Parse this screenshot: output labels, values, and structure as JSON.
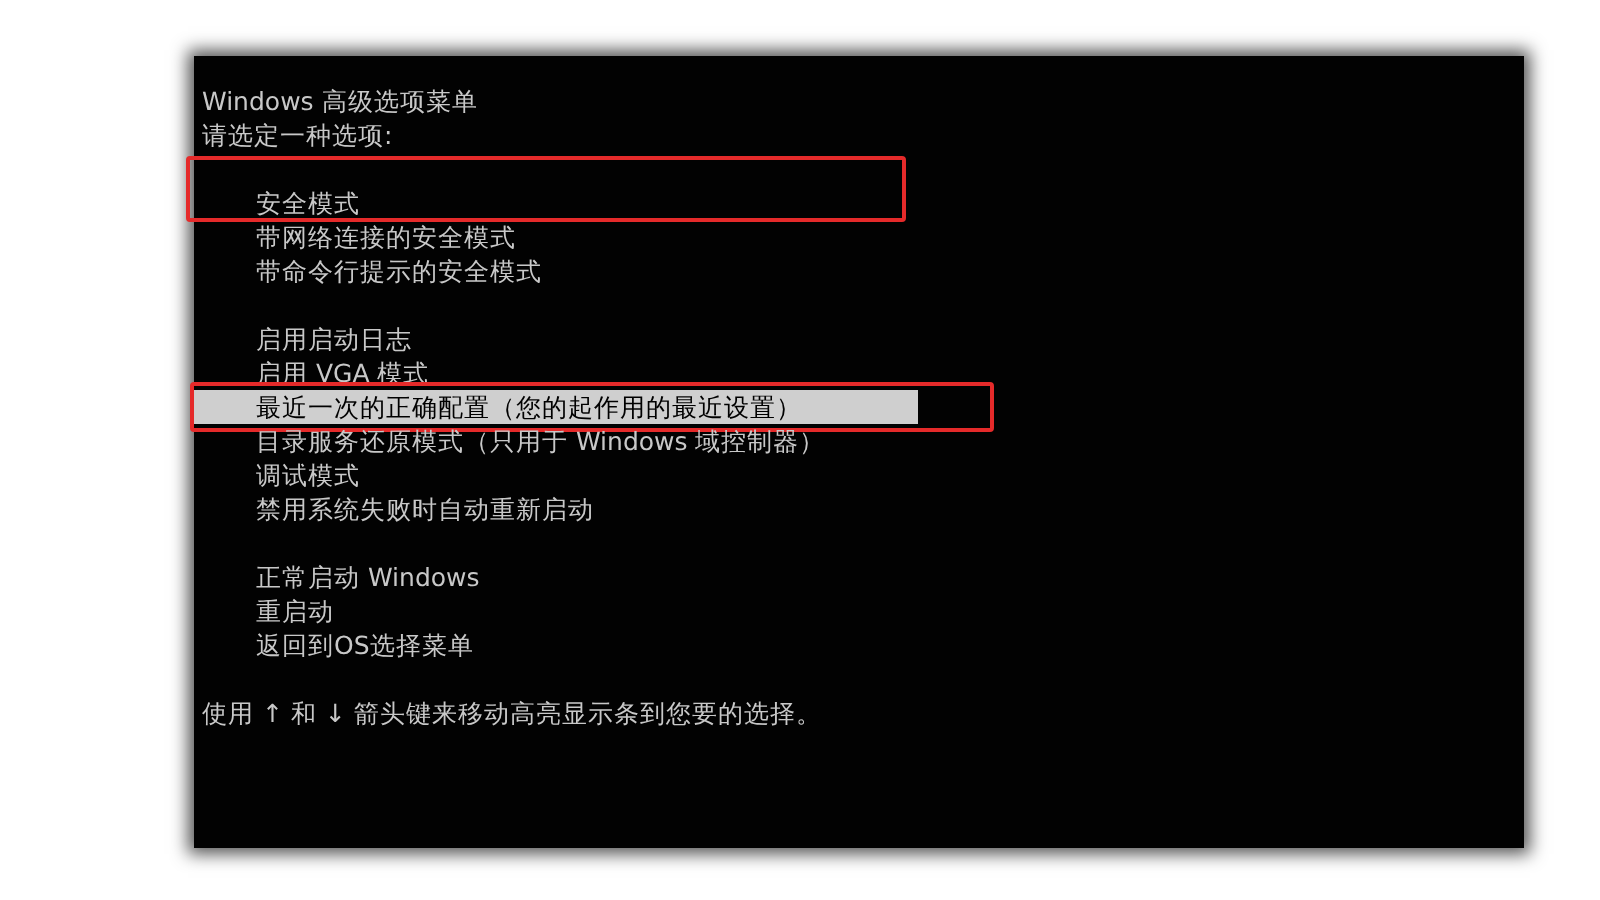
{
  "title": "Windows 高级选项菜单",
  "prompt": "请选定一种选项:",
  "groups": [
    [
      {
        "label": "安全模式",
        "selected": false,
        "annotated": true
      },
      {
        "label": "带网络连接的安全模式",
        "selected": false,
        "annotated": false
      },
      {
        "label": "带命令行提示的安全模式",
        "selected": false,
        "annotated": false
      }
    ],
    [
      {
        "label": "启用启动日志",
        "selected": false,
        "annotated": false
      },
      {
        "label": "启用 VGA 模式",
        "selected": false,
        "annotated": false
      },
      {
        "label": "最近一次的正确配置（您的起作用的最近设置）",
        "selected": true,
        "annotated": true
      },
      {
        "label": "目录服务还原模式（只用于 Windows 域控制器）",
        "selected": false,
        "annotated": false
      },
      {
        "label": "调试模式",
        "selected": false,
        "annotated": false
      },
      {
        "label": "禁用系统失败时自动重新启动",
        "selected": false,
        "annotated": false
      }
    ],
    [
      {
        "label": "正常启动 Windows",
        "selected": false,
        "annotated": false
      },
      {
        "label": "重启动",
        "selected": false,
        "annotated": false
      },
      {
        "label": "返回到OS选择菜单",
        "selected": false,
        "annotated": false
      }
    ]
  ],
  "footer": "使用 ↑ 和 ↓ 箭头键来移动高亮显示条到您要的选择。"
}
